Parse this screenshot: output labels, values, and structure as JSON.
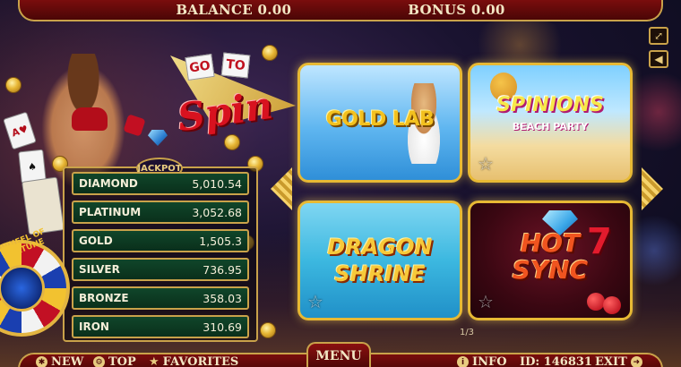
{
  "header": {
    "balance_text": "BALANCE 0.00",
    "bonus_text": "BONUS 0.00"
  },
  "controls": {
    "fullscreen_icon": "fullscreen-icon",
    "sound_icon": "speaker-icon"
  },
  "promo": {
    "logo_go": "GO",
    "logo_to": "TO",
    "logo_spin": "Spin",
    "jackpot_badge": "JACKPOT",
    "wheel_label": "WHEEL OF FORTUNE"
  },
  "jackpots": [
    {
      "name": "DIAMOND",
      "value": "5,010.54"
    },
    {
      "name": "PLATINUM",
      "value": "3,052.68"
    },
    {
      "name": "GOLD",
      "value": "1,505.3"
    },
    {
      "name": "SILVER",
      "value": "736.95"
    },
    {
      "name": "BRONZE",
      "value": "358.03"
    },
    {
      "name": "IRON",
      "value": "310.69"
    }
  ],
  "games": [
    {
      "title": "GOLD LAB"
    },
    {
      "title": "SPINIONS",
      "subtitle": "BEACH PARTY"
    },
    {
      "title_line1": "DRAGON",
      "title_line2": "SHRINE"
    },
    {
      "title_line1": "HOT",
      "title_line2": "SYNC"
    }
  ],
  "pagination": {
    "indicator": "1/3"
  },
  "footer": {
    "new_label": "NEW",
    "top_label": "TOP",
    "favorites_label": "FAVORITES",
    "menu_label": "MENU",
    "info_label": "INFO",
    "id_label": "ID: 146831",
    "exit_label": "EXIT"
  },
  "colors": {
    "bar_red": "#7a0d0d",
    "gold_border": "#c9a24a",
    "jackpot_green": "#10462a",
    "tile_glow": "#e7b934"
  }
}
